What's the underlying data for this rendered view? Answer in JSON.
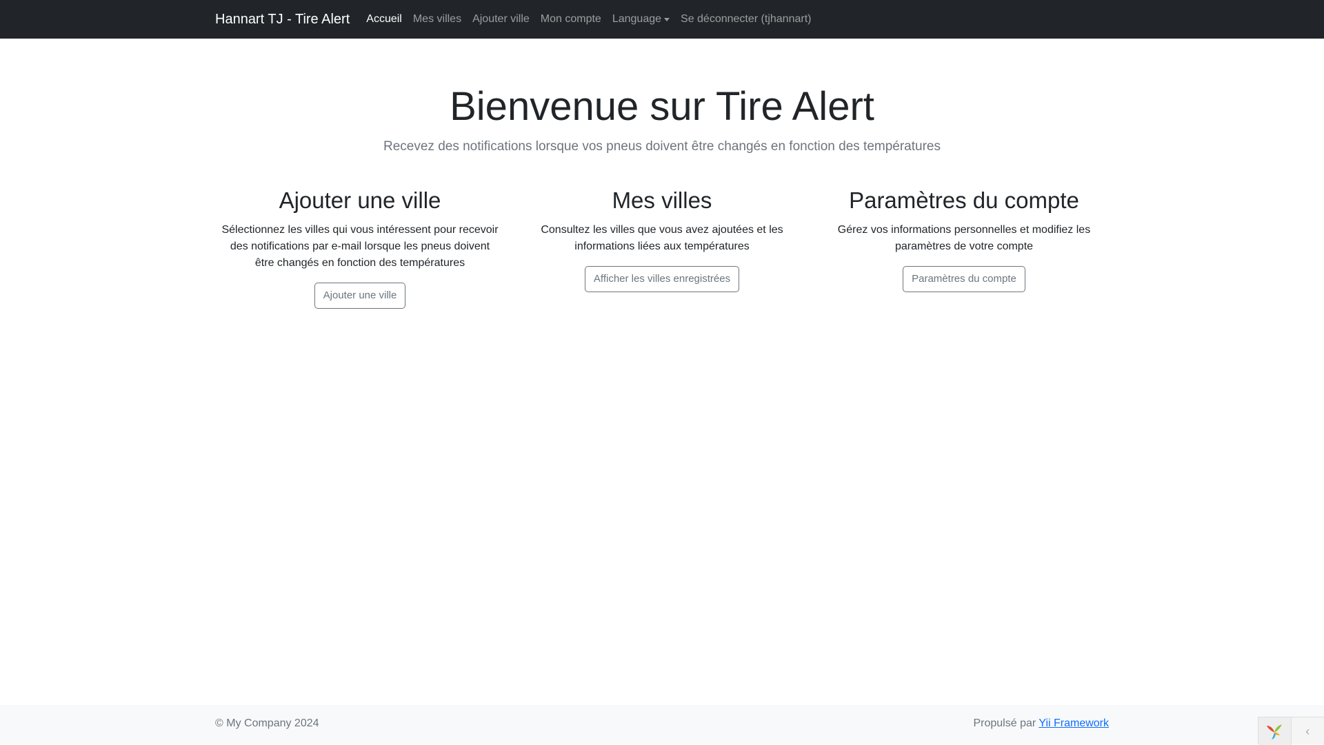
{
  "navbar": {
    "brand": "Hannart TJ - Tire Alert",
    "links": [
      {
        "label": "Accueil",
        "active": true
      },
      {
        "label": "Mes villes",
        "active": false
      },
      {
        "label": "Ajouter ville",
        "active": false
      },
      {
        "label": "Mon compte",
        "active": false
      },
      {
        "label": "Language",
        "active": false,
        "dropdown": true
      },
      {
        "label": "Se déconnecter (tjhannart)",
        "active": false
      }
    ]
  },
  "hero": {
    "title": "Bienvenue sur Tire Alert",
    "subtitle": "Recevez des notifications lorsque vos pneus doivent être changés en fonction des températures"
  },
  "features": [
    {
      "title": "Ajouter une ville",
      "text": "Sélectionnez les villes qui vous intéressent pour recevoir des notifications par e-mail lorsque les pneus doivent être changés en fonction des températures",
      "button": "Ajouter une ville"
    },
    {
      "title": "Mes villes",
      "text": "Consultez les villes que vous avez ajoutées et les informations liées aux températures",
      "button": "Afficher les villes enregistrées"
    },
    {
      "title": "Paramètres du compte",
      "text": "Gérez vos informations personnelles et modifiez les paramètres de votre compte",
      "button": "Paramètres du compte"
    }
  ],
  "footer": {
    "copyright": "© My Company 2024",
    "powered_prefix": "Propulsé par",
    "powered_link": "Yii Framework"
  },
  "debug_toolbar": {
    "logo_icon": "yii-logo-icon",
    "toggle_icon": "chevron-left-icon",
    "toggle_glyph": "‹"
  },
  "colors": {
    "navbar_bg": "#212529",
    "footer_bg": "#f8f9fa",
    "link": "#0d6efd",
    "muted": "#6c757d"
  }
}
